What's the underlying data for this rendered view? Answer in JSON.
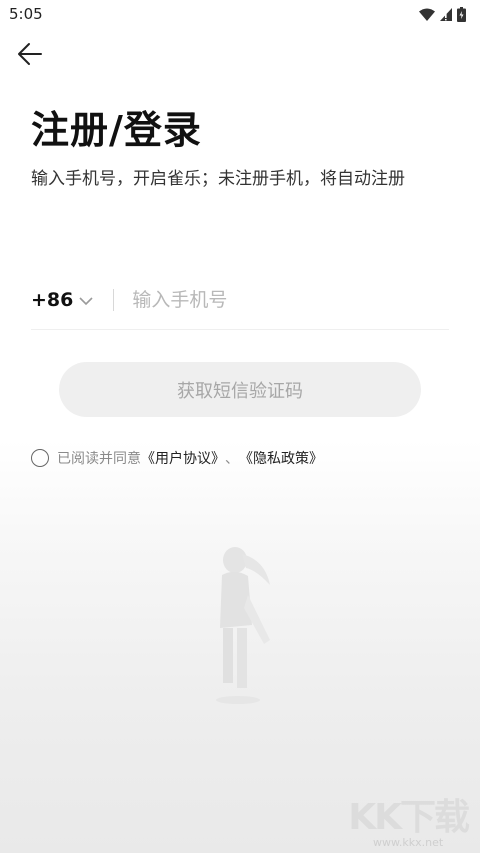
{
  "status_bar": {
    "time": "5:05",
    "icons": [
      "wifi-icon",
      "signal-icon",
      "battery-icon"
    ]
  },
  "header": {
    "back_icon": "arrow-left-icon"
  },
  "main": {
    "title": "注册/登录",
    "subtitle": "输入手机号，开启雀乐；未注册手机，将自动注册",
    "phone": {
      "country_code": "+86",
      "country_dropdown_icon": "chevron-down-icon",
      "value": "",
      "placeholder": "输入手机号"
    },
    "sms_button_label": "获取短信验证码",
    "agreement": {
      "checked": false,
      "prefix": "已阅读并同意",
      "user_agreement": "《用户协议》",
      "separator": "、",
      "privacy_policy": "《隐私政策》"
    }
  },
  "watermark": {
    "logo": "KK下载",
    "url": "www.kkx.net"
  },
  "colors": {
    "background": "#ffffff",
    "title": "#111111",
    "button_bg": "#efefef",
    "button_text": "#a7a7a7",
    "placeholder": "#b8b8b8"
  }
}
